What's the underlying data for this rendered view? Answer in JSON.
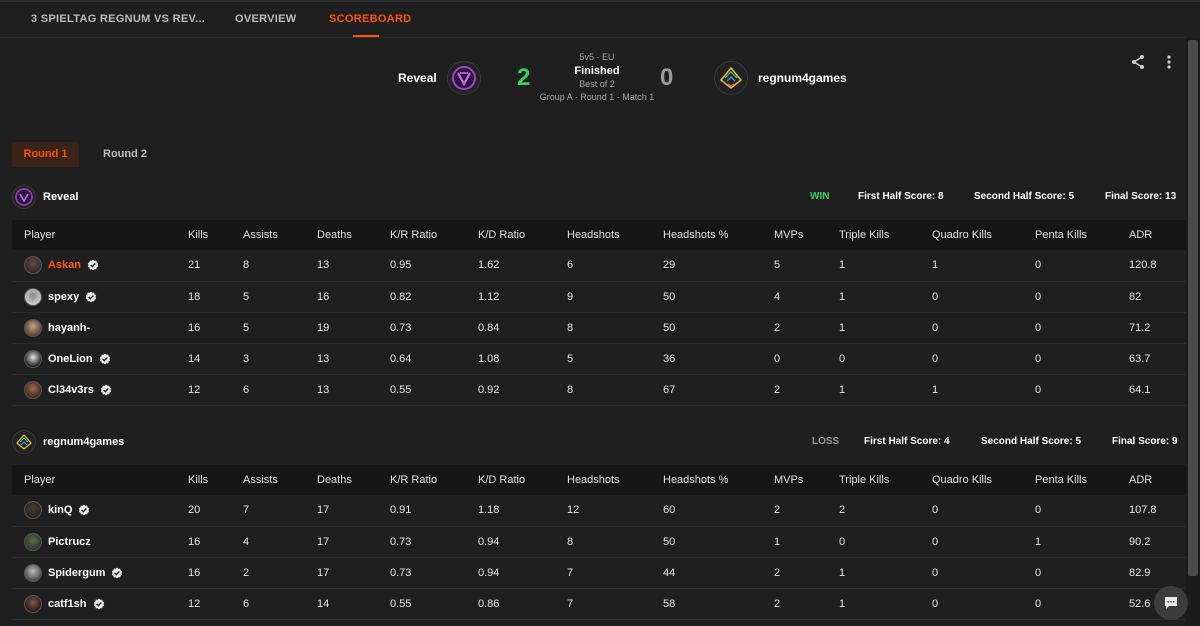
{
  "nav": {
    "tabs": [
      {
        "label": "3 SPIELTAG REGNUM VS REV..."
      },
      {
        "label": "OVERVIEW"
      },
      {
        "label": "SCOREBOARD"
      }
    ]
  },
  "match": {
    "format": "5v5 · EU",
    "status": "Finished",
    "best_of": "Best of 2",
    "group": "Group A · Round 1 · Match 1",
    "team1": {
      "name": "Reveal",
      "score": "2"
    },
    "team2": {
      "name": "regnum4games",
      "score": "0"
    }
  },
  "rounds": [
    {
      "label": "Round 1"
    },
    {
      "label": "Round 2"
    }
  ],
  "columns": [
    "Player",
    "Kills",
    "Assists",
    "Deaths",
    "K/R Ratio",
    "K/D Ratio",
    "Headshots",
    "Headshots %",
    "MVPs",
    "Triple Kills",
    "Quadro Kills",
    "Penta Kills",
    "ADR"
  ],
  "teams": [
    {
      "name": "Reveal",
      "result": "WIN",
      "first_half": "First Half Score: 8",
      "second_half": "Second Half Score: 5",
      "final": "Final Score: 13",
      "players": [
        {
          "name": "Askan",
          "verified": true,
          "highlight": true,
          "stats": [
            "21",
            "8",
            "13",
            "0.95",
            "1.62",
            "6",
            "29",
            "5",
            "1",
            "1",
            "0",
            "120.8"
          ]
        },
        {
          "name": "spexy",
          "verified": true,
          "stats": [
            "18",
            "5",
            "16",
            "0.82",
            "1.12",
            "9",
            "50",
            "4",
            "1",
            "0",
            "0",
            "82"
          ]
        },
        {
          "name": "hayanh-",
          "verified": false,
          "stats": [
            "16",
            "5",
            "19",
            "0.73",
            "0.84",
            "8",
            "50",
            "2",
            "1",
            "0",
            "0",
            "71.2"
          ]
        },
        {
          "name": "OneLion",
          "verified": true,
          "stats": [
            "14",
            "3",
            "13",
            "0.64",
            "1.08",
            "5",
            "36",
            "0",
            "0",
            "0",
            "0",
            "63.7"
          ]
        },
        {
          "name": "Cl34v3rs",
          "verified": true,
          "stats": [
            "12",
            "6",
            "13",
            "0.55",
            "0.92",
            "8",
            "67",
            "2",
            "1",
            "1",
            "0",
            "64.1"
          ]
        }
      ]
    },
    {
      "name": "regnum4games",
      "result": "LOSS",
      "first_half": "First Half Score: 4",
      "second_half": "Second Half Score: 5",
      "final": "Final Score: 9",
      "players": [
        {
          "name": "kinQ",
          "verified": true,
          "stats": [
            "20",
            "7",
            "17",
            "0.91",
            "1.18",
            "12",
            "60",
            "2",
            "2",
            "0",
            "0",
            "107.8"
          ]
        },
        {
          "name": "Pictrucz",
          "verified": false,
          "stats": [
            "16",
            "4",
            "17",
            "0.73",
            "0.94",
            "8",
            "50",
            "1",
            "0",
            "0",
            "1",
            "90.2"
          ]
        },
        {
          "name": "Spidergum",
          "verified": true,
          "stats": [
            "16",
            "2",
            "17",
            "0.73",
            "0.94",
            "7",
            "44",
            "2",
            "1",
            "0",
            "0",
            "82.9"
          ]
        },
        {
          "name": "catf1sh",
          "verified": true,
          "stats": [
            "12",
            "6",
            "14",
            "0.55",
            "0.86",
            "7",
            "58",
            "2",
            "1",
            "0",
            "0",
            "52.6"
          ]
        }
      ]
    }
  ],
  "colors": {
    "accent": "#ff5500",
    "win": "#32d35f",
    "loss": "#9a9a9a"
  }
}
